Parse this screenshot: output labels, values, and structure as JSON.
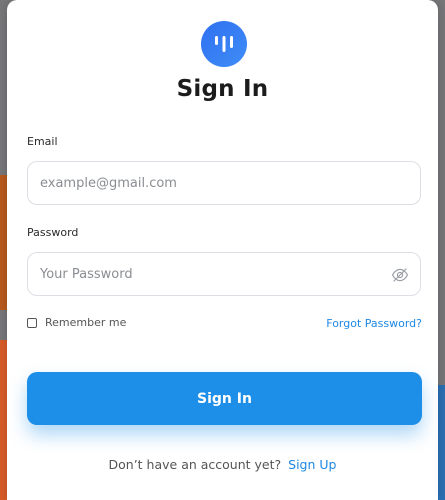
{
  "modal": {
    "title": "Sign In",
    "logo_icon": "app-logo-icon",
    "email": {
      "label": "Email",
      "placeholder": "example@gmail.com",
      "value": ""
    },
    "password": {
      "label": "Password",
      "placeholder": "Your Password",
      "value": "",
      "toggle_icon": "eye-slash-icon"
    },
    "remember": {
      "label": "Remember me",
      "checked": false
    },
    "forgot_label": "Forgot Password?",
    "submit_label": "Sign In",
    "signup": {
      "prompt": "Don’t have an account yet?",
      "link_label": "Sign Up"
    }
  },
  "colors": {
    "accent": "#1e8fe8",
    "link": "#1e88e5",
    "logo_gradient_start": "#2f6ff0",
    "logo_gradient_end": "#3f8ef7"
  }
}
